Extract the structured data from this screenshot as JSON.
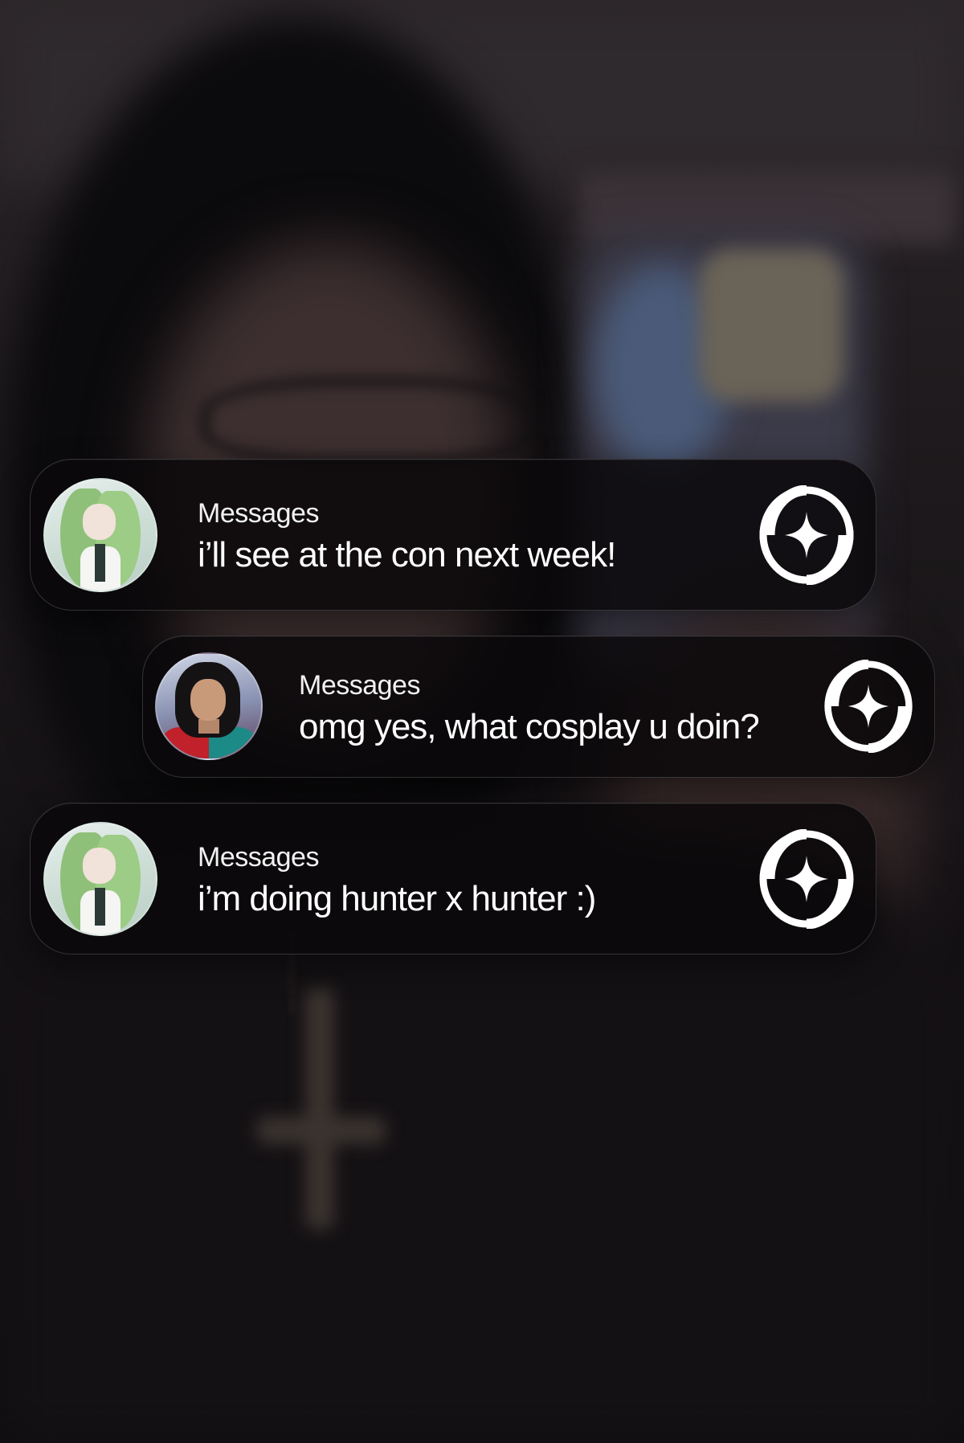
{
  "notifications": [
    {
      "app_name": "Messages",
      "message": "i’ll see at the con next week!",
      "avatar_icon": "avatar-green-hair",
      "action_icon": "sparkle-icon"
    },
    {
      "app_name": "Messages",
      "message": "omg yes, what cosplay u doin?",
      "avatar_icon": "avatar-man",
      "action_icon": "sparkle-icon"
    },
    {
      "app_name": "Messages",
      "message": "i’m doing hunter x hunter :)",
      "avatar_icon": "avatar-green-hair",
      "action_icon": "sparkle-icon"
    }
  ],
  "colors": {
    "card_background": "#0a080b",
    "text": "#ffffff",
    "icon": "#ffffff"
  }
}
